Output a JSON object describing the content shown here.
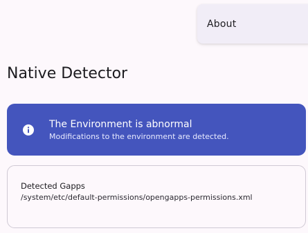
{
  "menu": {
    "items": [
      {
        "label": "About"
      }
    ]
  },
  "header": {
    "title": "Native Detector"
  },
  "status": {
    "icon": "info-icon",
    "title": "The Environment is abnormal",
    "subtitle": "Modifications to the environment are detected.",
    "color": "#4455bd"
  },
  "detections": [
    {
      "title": "Detected Gapps",
      "path": "/system/etc/default-permissions/opengapps-permissions.xml"
    }
  ]
}
